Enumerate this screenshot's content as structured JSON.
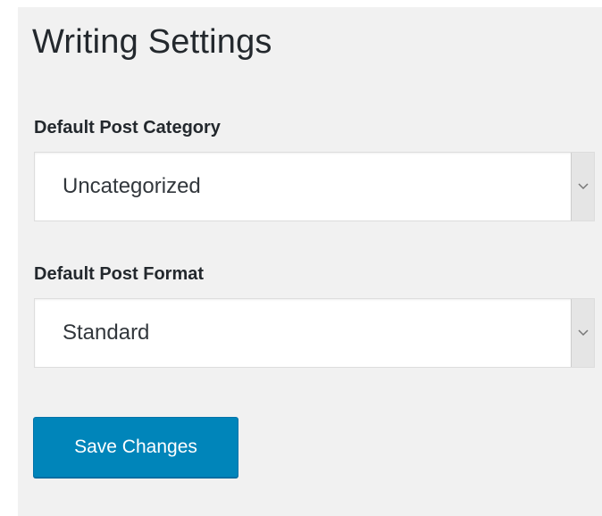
{
  "page": {
    "title": "Writing Settings"
  },
  "fields": {
    "default_post_category": {
      "label": "Default Post Category",
      "value": "Uncategorized"
    },
    "default_post_format": {
      "label": "Default Post Format",
      "value": "Standard"
    }
  },
  "actions": {
    "save_label": "Save Changes"
  },
  "icons": {
    "select_arrow": "chevron-down-icon"
  },
  "colors": {
    "primary_button": "#0085ba",
    "panel_background": "#f1f1f1",
    "text": "#23282d"
  }
}
